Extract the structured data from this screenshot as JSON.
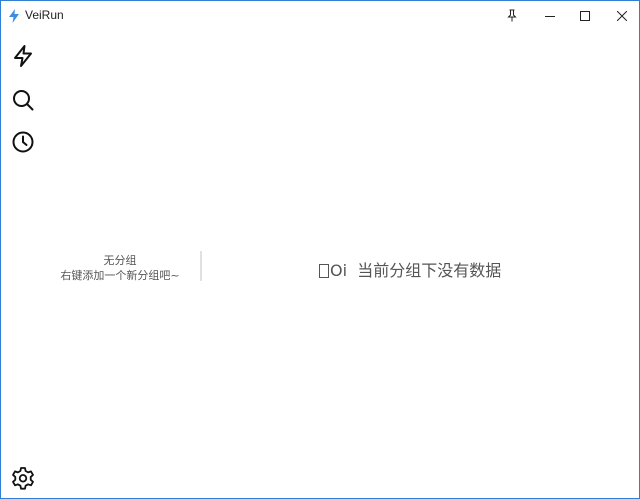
{
  "window": {
    "title": "VeiRun",
    "controls": [
      "pin",
      "minimize",
      "maximize",
      "close"
    ],
    "border_color": "#2f7fd4",
    "accent_color": "#3b8fe3"
  },
  "sidebar": {
    "icons": [
      "lightning-icon",
      "search-icon",
      "clock-icon"
    ],
    "bottom_icon": "gear-icon"
  },
  "group_panel": {
    "title": "无分组",
    "hint": "右键添加一个新分组吧~"
  },
  "content": {
    "empty_prefix": "Oi",
    "empty_message": "当前分组下没有数据"
  }
}
